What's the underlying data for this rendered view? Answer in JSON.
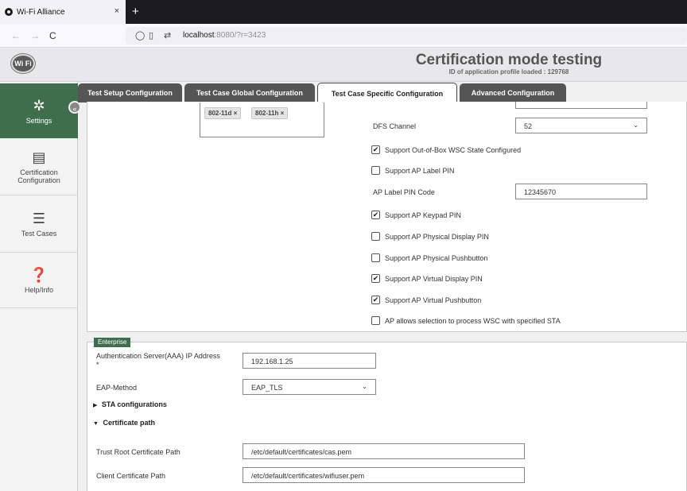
{
  "browser": {
    "tab_title": "Wi-Fi Alliance",
    "tab_close": "×",
    "new_tab": "+",
    "back": "←",
    "forward": "→",
    "reload": "C",
    "url_host": "localhost",
    "url_path": ":8080/?r=3423"
  },
  "header": {
    "logo_text": "Wi Fi",
    "title": "Certification mode testing",
    "subtitle": "ID of application profile loaded : 129768"
  },
  "sidebar": {
    "items": [
      {
        "label": "Settings",
        "icon": "gear-icon"
      },
      {
        "label": "Certification Configuration",
        "icon": "id-card-icon"
      },
      {
        "label": "Test Cases",
        "icon": "list-icon"
      },
      {
        "label": "Help/Info",
        "icon": "question-icon"
      }
    ],
    "collapse_glyph": "«"
  },
  "tabs": [
    {
      "label": "Test Setup Configuration",
      "active": false
    },
    {
      "label": "Test Case Global Configuration",
      "active": false
    },
    {
      "label": "Test Case Specific Configuration",
      "active": true
    },
    {
      "label": "Advanced Configuration",
      "active": false
    }
  ],
  "bands": [
    "802-11d ×",
    "802-11h ×"
  ],
  "dfs": {
    "label": "DFS Channel",
    "value": "52"
  },
  "checkboxes": [
    {
      "label": "Support Out-of-Box WSC State Configured",
      "checked": true
    },
    {
      "label": "Support AP Label PIN",
      "checked": false
    },
    {
      "label": "Support AP Keypad PIN",
      "checked": true
    },
    {
      "label": "Support AP Physical Display PIN",
      "checked": false
    },
    {
      "label": "Support AP Physical Pushbutton",
      "checked": false
    },
    {
      "label": "Support AP Virtual Display PIN",
      "checked": true
    },
    {
      "label": "Support AP Virtual Pushbutton",
      "checked": true
    },
    {
      "label": "AP allows selection to process WSC with specified STA",
      "checked": false
    }
  ],
  "ap_label_pin": {
    "label": "AP Label PIN Code",
    "value": "12345670"
  },
  "enterprise": {
    "legend": "Enterprise",
    "aaa_label": "Authentication Server(AAA) IP Address",
    "aaa_required": "*",
    "aaa_value": "192.168.1.25",
    "eap_label": "EAP-Method",
    "eap_value": "EAP_TLS",
    "sta_section": "STA configurations",
    "cert_section": "Certificate path",
    "trust_label": "Trust Root Certificate Path",
    "trust_value": "/etc/default/certificates/cas.pem",
    "client_label": "Client Certificate Path",
    "client_value": "/etc/default/certificates/wifiuser.pem"
  },
  "colors": {
    "accent": "#3f6e4c",
    "tab_dark": "#555555"
  }
}
